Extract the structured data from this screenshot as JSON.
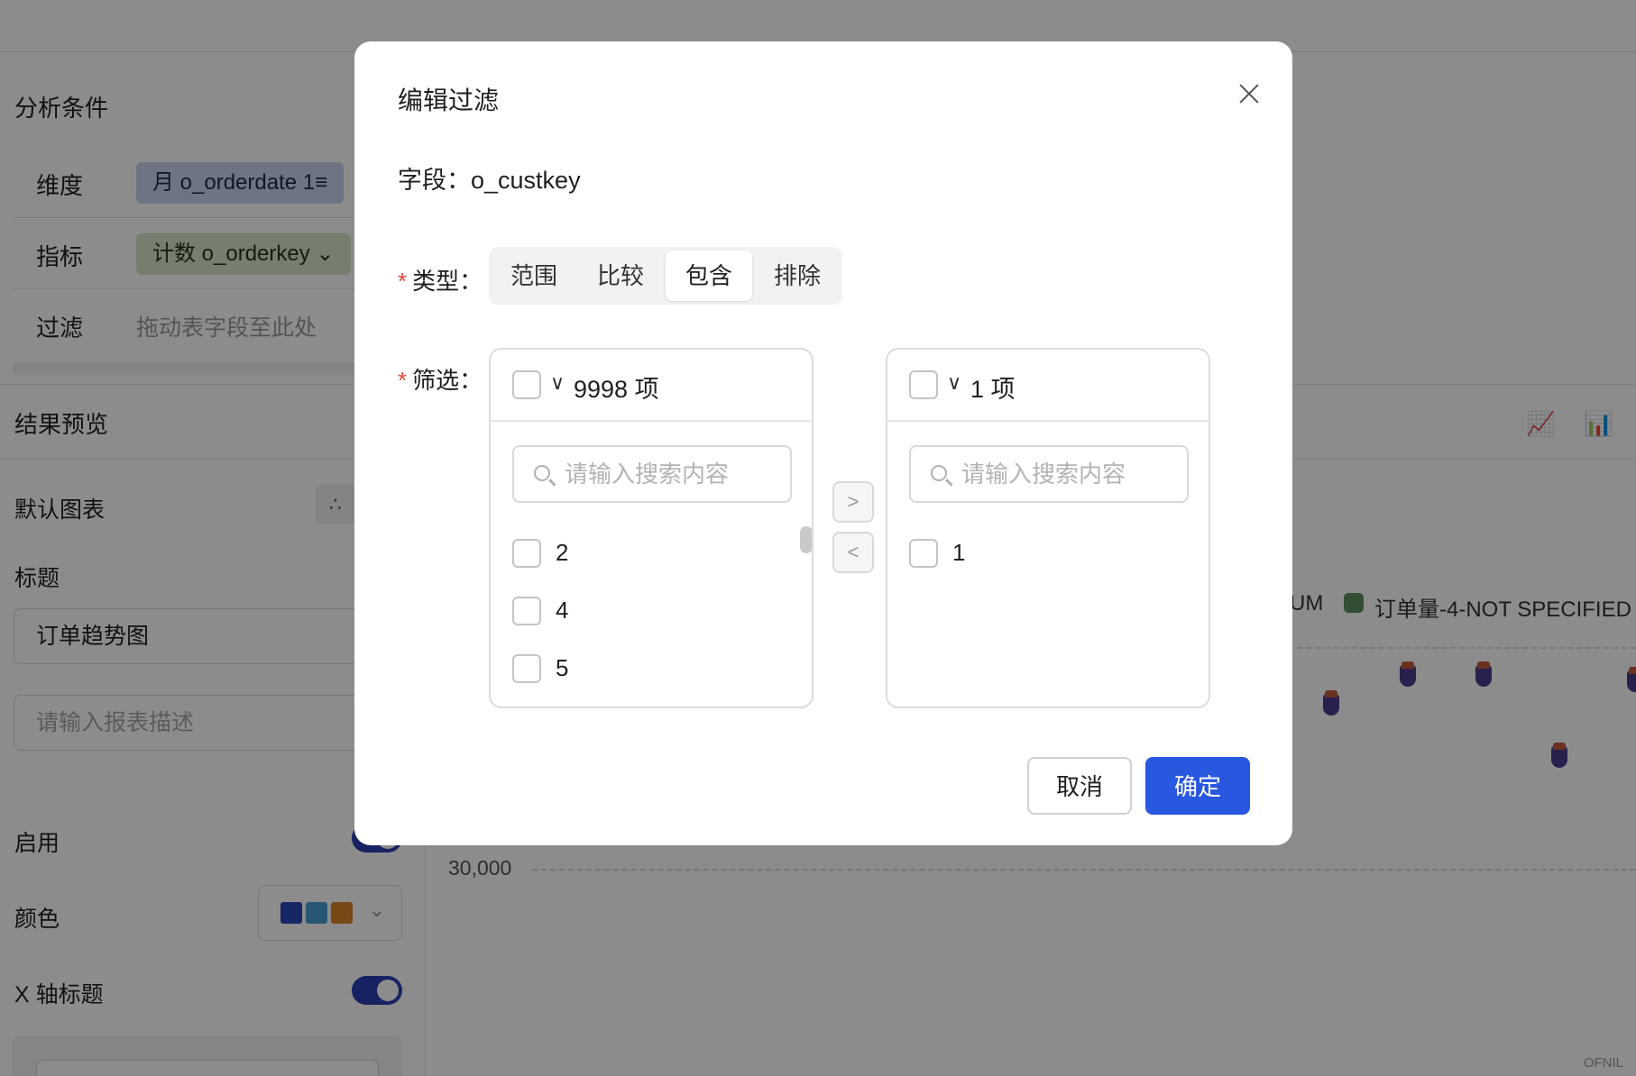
{
  "page": {
    "analysis_title": "分析条件",
    "dimension_label": "维度",
    "dimension_chip": "月 o_orderdate 1≡",
    "metric_label": "指标",
    "metric_chip": "计数 o_orderkey ⌄",
    "filter_label": "过滤",
    "filter_hint": "拖动表字段至此处",
    "preview_title": "结果预览",
    "default_chart_label": "默认图表",
    "title_label": "标题",
    "title_value": "订单趋势图",
    "desc_placeholder": "请输入报表描述",
    "enable_label": "启用",
    "color_label": "颜色",
    "xaxis_title_label": "X 轴标题",
    "palette": [
      "#2b48b8",
      "#4a9fd6",
      "#d8862a"
    ],
    "legend_partial_left": "UM",
    "legend_series": "订单量-4-NOT SPECIFIED",
    "y_tick": "30,000",
    "watermark": "OFNIL"
  },
  "modal": {
    "title": "编辑过滤",
    "field_text": "字段：o_custkey",
    "type_label": "类型：",
    "type_options": [
      "范围",
      "比较",
      "包含",
      "排除"
    ],
    "type_selected": "包含",
    "filter_label": "筛选：",
    "left_panel": {
      "count": "9998 项",
      "search_placeholder": "请输入搜索内容",
      "items": [
        "2",
        "4",
        "5"
      ]
    },
    "right_panel": {
      "count": "1 项",
      "search_placeholder": "请输入搜索内容",
      "items": [
        "1"
      ]
    },
    "move_right": ">",
    "move_left": "<",
    "cancel": "取消",
    "confirm": "确定"
  }
}
